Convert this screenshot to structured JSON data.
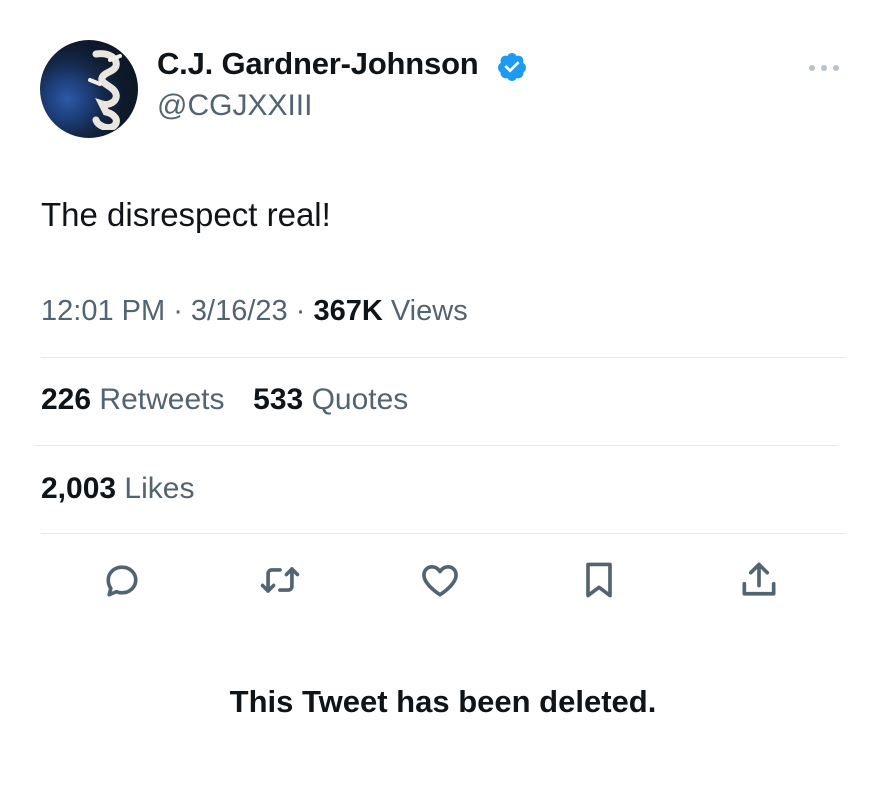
{
  "author": {
    "display_name": "C.J. Gardner-Johnson",
    "handle": "@CGJXXIII",
    "avatar_icon": "avatar",
    "verified_icon": "verified-badge-icon",
    "verified_color": "#1d9bf0"
  },
  "tweet": {
    "text": "The disrespect real!",
    "time": "12:01 PM",
    "date": "3/16/23",
    "views_count": "367K",
    "views_label": "Views"
  },
  "stats": {
    "retweets_count": "226",
    "retweets_label": "Retweets",
    "quotes_count": "533",
    "quotes_label": "Quotes",
    "likes_count": "2,003",
    "likes_label": "Likes"
  },
  "actions": [
    "reply-icon",
    "retweet-icon",
    "like-icon",
    "bookmark-icon",
    "share-icon"
  ],
  "notice": "This Tweet has been deleted.",
  "colors": {
    "text": "#0f1419",
    "secondary": "#536471",
    "divider": "#e6e9ec"
  }
}
